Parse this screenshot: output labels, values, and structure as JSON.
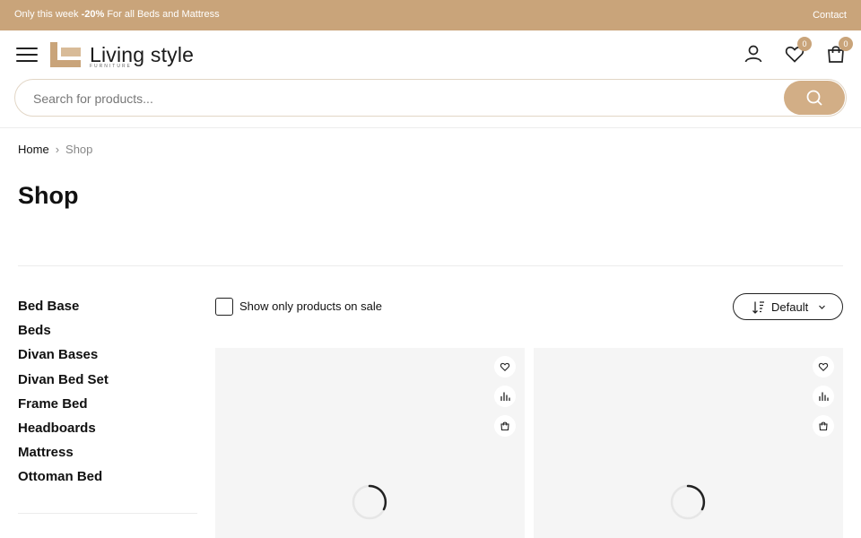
{
  "announcement": {
    "prefix": "Only this week ",
    "discount": "-20%",
    "suffix": " For all Beds and Mattress",
    "contact_label": "Contact"
  },
  "header": {
    "logo_text": "Living style",
    "logo_sub": "FURNITURE",
    "wishlist_count": "0",
    "cart_count": "0"
  },
  "search": {
    "placeholder": "Search for products..."
  },
  "breadcrumb": {
    "home": "Home",
    "separator": "›",
    "current": "Shop"
  },
  "page": {
    "title": "Shop"
  },
  "sidebar": {
    "categories": [
      "Bed Base",
      "Beds",
      "Divan Bases",
      "Divan Bed Set",
      "Frame Bed",
      "Headboards",
      "Mattress",
      "Ottoman Bed"
    ]
  },
  "filters": {
    "sale_label": "Show only products on sale",
    "sort_label": "Default"
  },
  "colors": {
    "accent": "#c9a47a",
    "search_button": "#d2ae86",
    "card_background": "#f5f5f5"
  },
  "icons": {
    "menu": "hamburger-icon",
    "account": "user-icon",
    "wishlist": "heart-icon",
    "cart": "shopping-bag-icon",
    "search": "search-icon",
    "sort": "sort-icon",
    "compare": "bar-chart-icon",
    "loading": "spinner-icon"
  }
}
